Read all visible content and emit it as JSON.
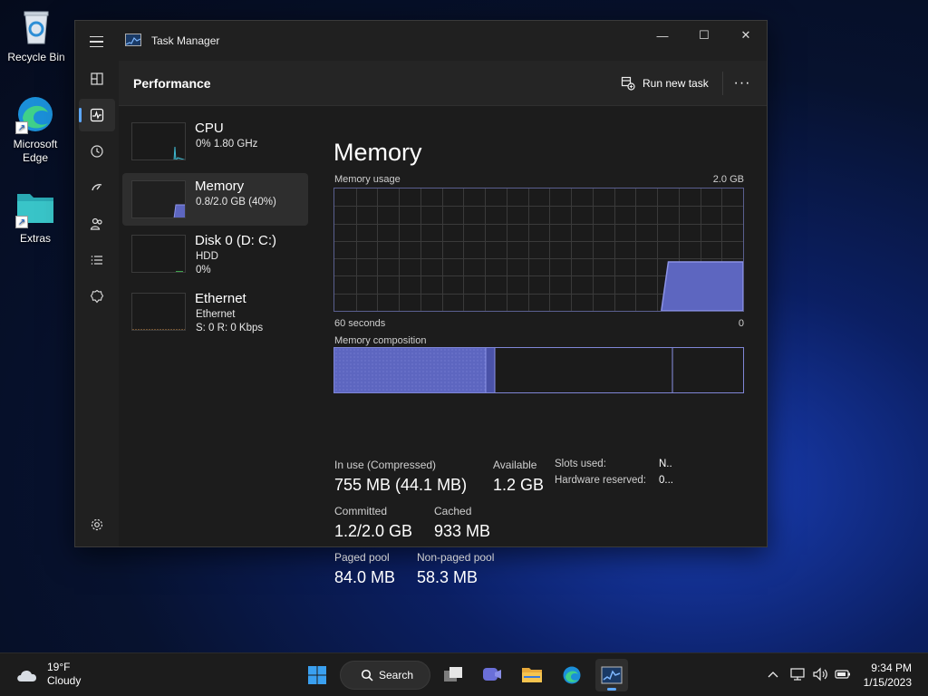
{
  "desktop": {
    "icons": [
      {
        "label": "Recycle Bin"
      },
      {
        "label": "Microsoft Edge"
      },
      {
        "label": "Extras"
      }
    ]
  },
  "window": {
    "title": "Task Manager",
    "controls": {
      "minimize": "—",
      "maximize": "☐",
      "close": "✕"
    },
    "nav": [
      "Processes",
      "Performance",
      "App history",
      "Startup apps",
      "Users",
      "Details",
      "Services",
      "Settings"
    ],
    "header": {
      "page_title": "Performance",
      "run_new_task": "Run new task",
      "more": "···"
    },
    "perf_list": [
      {
        "name": "CPU",
        "line1": "0% 1.80 GHz",
        "line2": ""
      },
      {
        "name": "Memory",
        "line1": "0.8/2.0 GB (40%)",
        "line2": ""
      },
      {
        "name": "Disk 0 (D: C:)",
        "line1": "HDD",
        "line2": "0%"
      },
      {
        "name": "Ethernet",
        "line1": "Ethernet",
        "line2": "S: 0 R: 0 Kbps"
      }
    ],
    "detail": {
      "title": "Memory",
      "usage_label": "Memory usage",
      "usage_max": "2.0 GB",
      "axis_left": "60 seconds",
      "axis_right": "0",
      "usage_fraction_recent": 0.4,
      "composition_label": "Memory composition",
      "stats": {
        "in_use_label": "In use (Compressed)",
        "in_use_value": "755 MB (44.1 MB)",
        "available_label": "Available",
        "available_value": "1.2 GB",
        "committed_label": "Committed",
        "committed_value": "1.2/2.0 GB",
        "cached_label": "Cached",
        "cached_value": "933 MB",
        "paged_label": "Paged pool",
        "paged_value": "84.0 MB",
        "nonpaged_label": "Non-paged pool",
        "nonpaged_value": "58.3 MB",
        "slots_label": "Slots used:",
        "slots_value": "N..",
        "hw_label": "Hardware reserved:",
        "hw_value": "0..."
      }
    }
  },
  "taskbar": {
    "weather_temp": "19°F",
    "weather_desc": "Cloudy",
    "search_label": "Search",
    "time": "9:34 PM",
    "date": "1/15/2023"
  },
  "colors": {
    "accent": "#5ca7ff",
    "memory_fill": "#5d66c0",
    "memory_line": "#8b92e6"
  }
}
